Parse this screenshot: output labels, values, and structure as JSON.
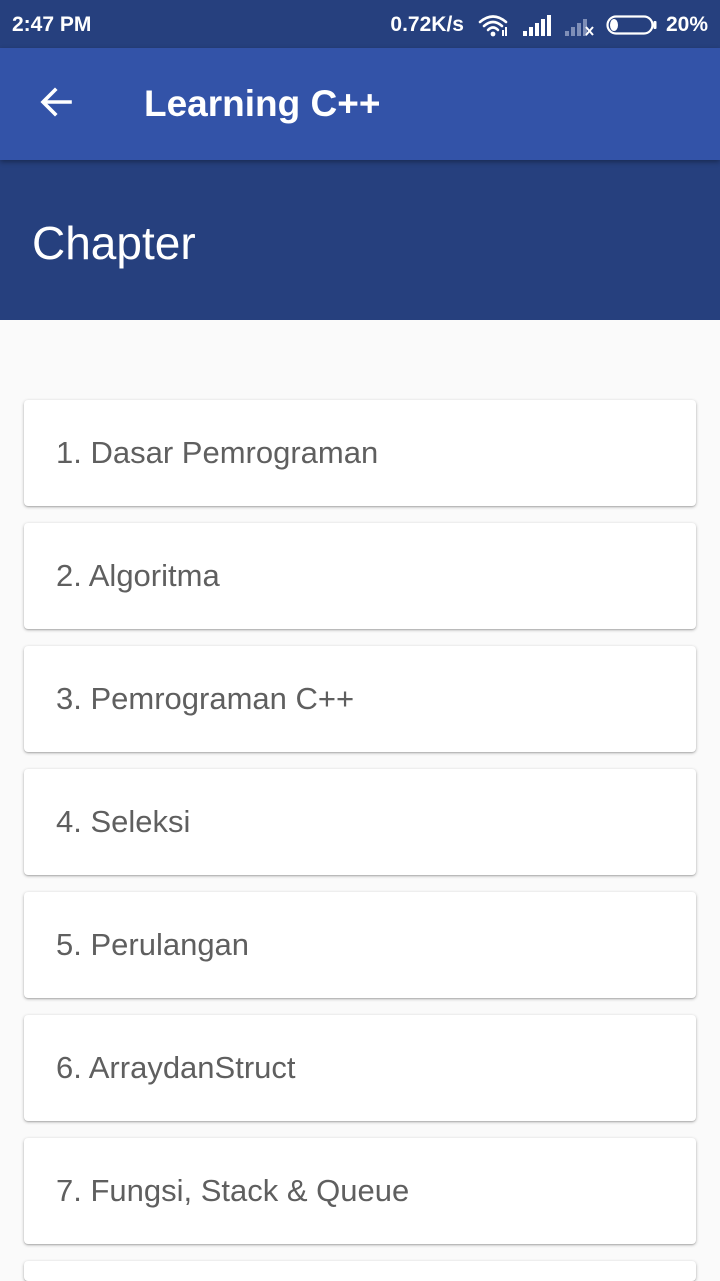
{
  "status_bar": {
    "time": "2:47 PM",
    "network_speed": "0.72K/s",
    "battery_percent": "20%",
    "battery_level": 0.2,
    "icons": [
      "wifi-icon",
      "signal-icon",
      "no-signal-icon",
      "battery-icon"
    ]
  },
  "app_bar": {
    "title": "Learning C++",
    "back_icon": "arrow-back-icon"
  },
  "header": {
    "title": "Chapter"
  },
  "chapters": [
    {
      "label": "1. Dasar Pemrograman"
    },
    {
      "label": "2. Algoritma"
    },
    {
      "label": "3. Pemrograman C++"
    },
    {
      "label": "4. Seleksi"
    },
    {
      "label": "5. Perulangan"
    },
    {
      "label": "6. ArraydanStruct"
    },
    {
      "label": "7. Fungsi, Stack & Queue"
    }
  ],
  "colors": {
    "status_bar": "#26407e",
    "app_bar": "#3353a8",
    "header": "#26407e",
    "background": "#fafafa",
    "card": "#ffffff",
    "card_text": "#5f5f5f"
  }
}
